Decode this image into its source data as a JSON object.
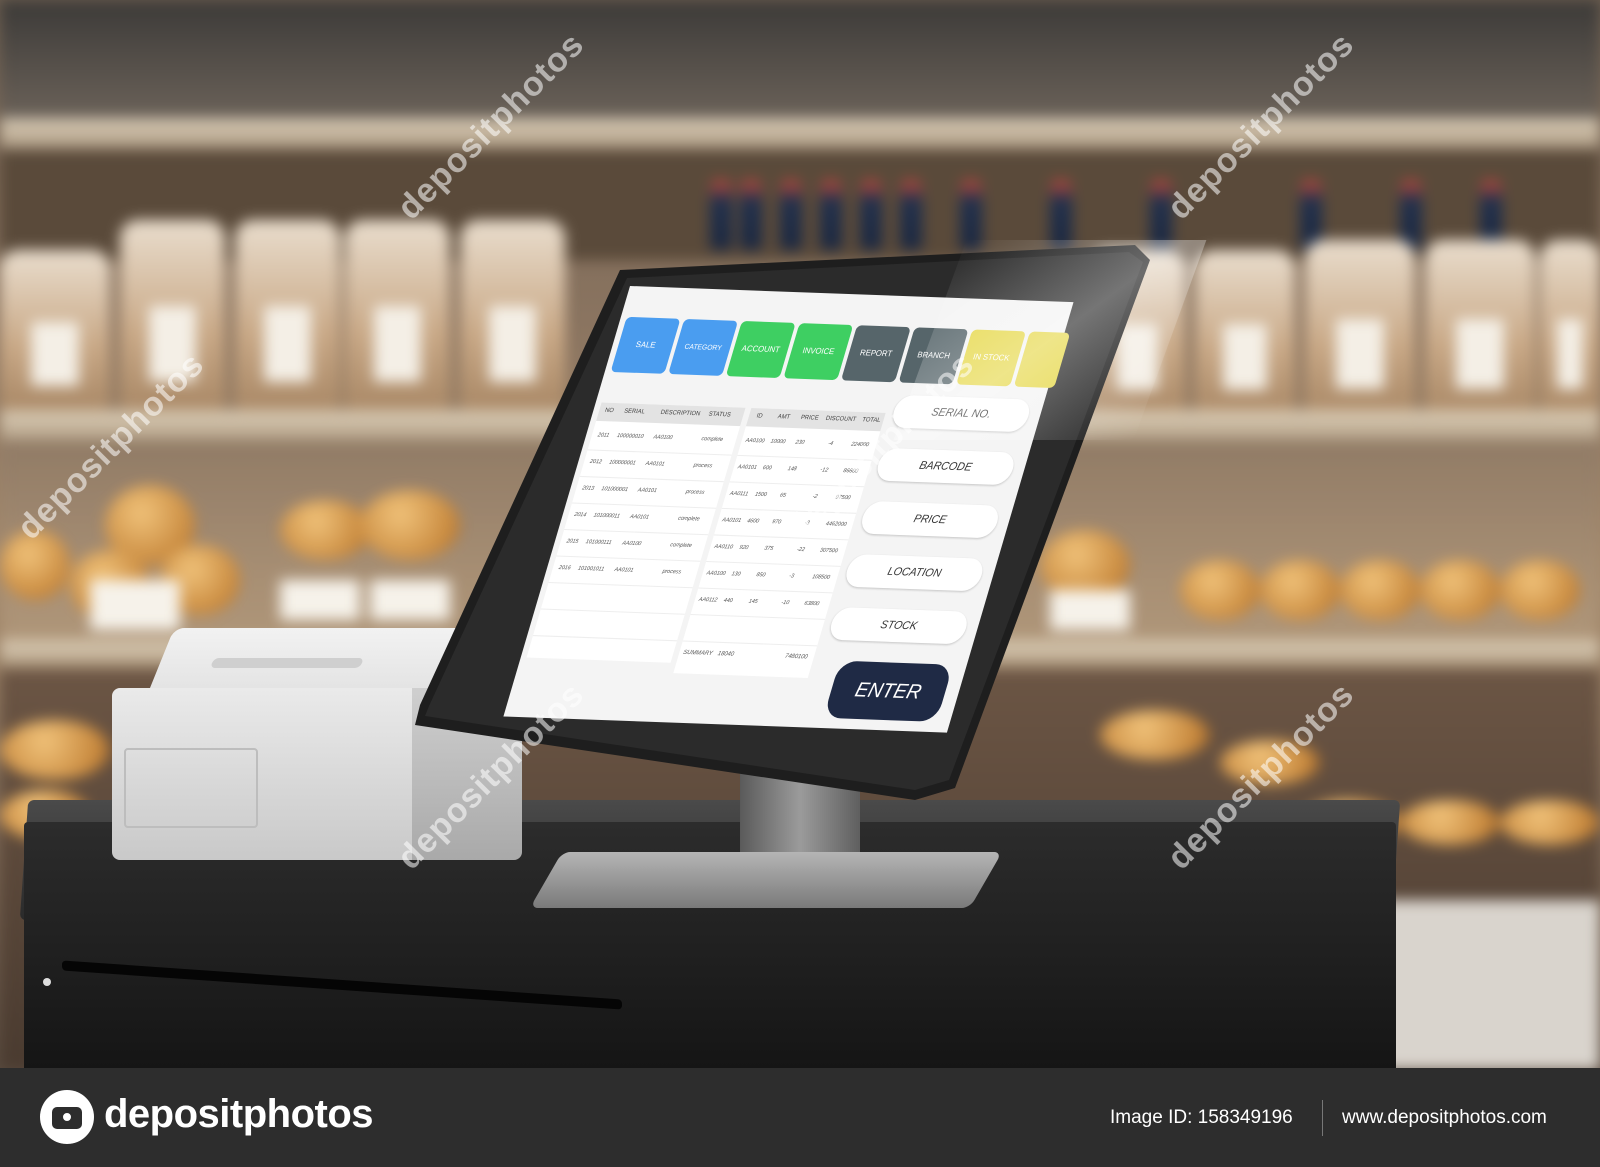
{
  "screen": {
    "tabs": [
      {
        "label": "SALE",
        "color": "#4a9df0"
      },
      {
        "label": "CATEGORY",
        "color": "#4a9df0"
      },
      {
        "label": "ACCOUNT",
        "color": "#3ecf62"
      },
      {
        "label": "INVOICE",
        "color": "#3ecf62"
      },
      {
        "label": "REPORT",
        "color": "#56656a"
      },
      {
        "label": "BRANCH",
        "color": "#56656a"
      },
      {
        "label": "IN STOCK",
        "color": "#e6d84a"
      },
      {
        "label": "",
        "color": "#e6d84a"
      }
    ],
    "left_table": {
      "headers": [
        "NO",
        "SERIAL",
        "DESCRIPTION",
        "STATUS"
      ],
      "rows": [
        [
          "2011",
          "100000010",
          "AA0100",
          "complete"
        ],
        [
          "2012",
          "100000001",
          "AA0101",
          "process"
        ],
        [
          "2013",
          "101000001",
          "AA0101",
          "process"
        ],
        [
          "2014",
          "101000011",
          "AA0101",
          "complete"
        ],
        [
          "2015",
          "101000111",
          "AA0100",
          "complete"
        ],
        [
          "2016",
          "101001011",
          "AA0101",
          "process"
        ]
      ]
    },
    "right_table": {
      "headers": [
        "ID",
        "AMT",
        "PRICE",
        "DISCOUNT",
        "TOTAL"
      ],
      "rows": [
        [
          "AA0100",
          "10000",
          "230",
          "-4",
          "224000"
        ],
        [
          "AA0101",
          "600",
          "148",
          "-12",
          "86600"
        ],
        [
          "AA0111",
          "1500",
          "65",
          "-2",
          "97500"
        ],
        [
          "AA0101",
          "4600",
          "970",
          "-3",
          "4462000"
        ],
        [
          "AA0110",
          "920",
          "375",
          "-22",
          "307500"
        ],
        [
          "AA0100",
          "130",
          "850",
          "-3",
          "108500"
        ],
        [
          "AA0112",
          "440",
          "145",
          "-10",
          "63800"
        ]
      ],
      "summary_label": "SUMMARY",
      "summary_code": "18040",
      "summary_total": "7480100"
    },
    "buttons": [
      "SERIAL NO.",
      "BARCODE",
      "PRICE",
      "LOCATION",
      "STOCK"
    ],
    "enter_label": "ENTER"
  },
  "watermark_text": "depositphotos",
  "footer": {
    "brand": "depositphotos",
    "image_id": "Image ID: 158349196",
    "website": "www.depositphotos.com"
  }
}
